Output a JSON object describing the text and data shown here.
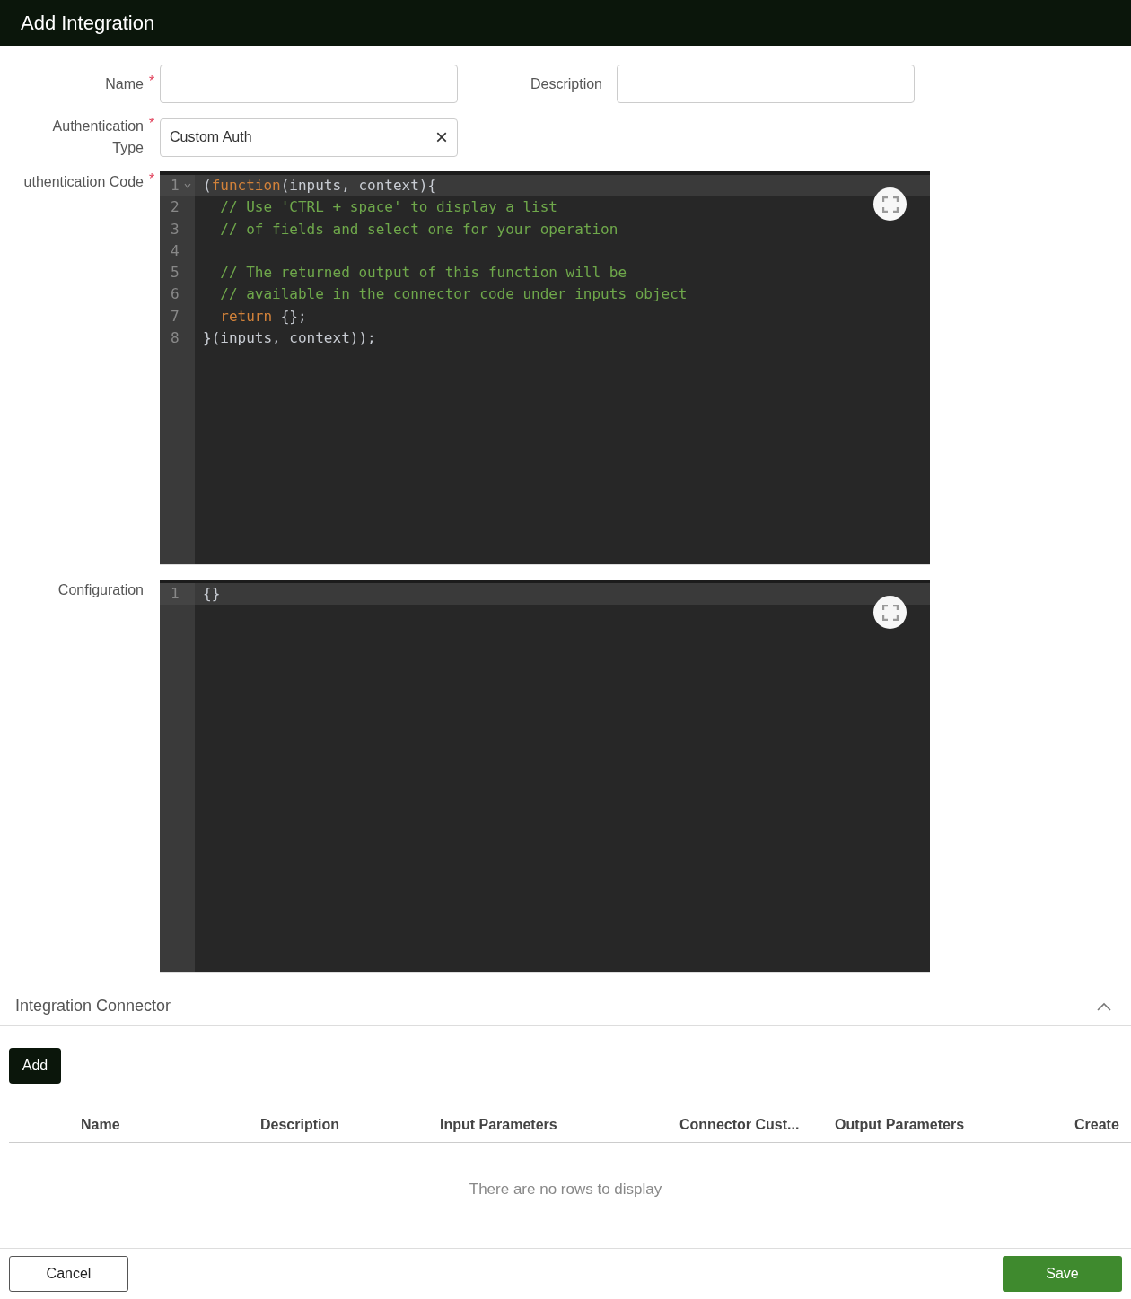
{
  "window": {
    "title": "Add Integration"
  },
  "form": {
    "name": {
      "label": "Name",
      "required_marker": "*"
    },
    "description": {
      "label": "Description"
    },
    "auth_type": {
      "label": "Authentication Type",
      "required_marker": "*",
      "value": "Custom Auth",
      "clear": "×"
    }
  },
  "editors": [
    {
      "label": "uthentication Code",
      "required_marker": "*",
      "lines": [
        {
          "number": "1",
          "foldable": true,
          "active": true,
          "tokens": [
            {
              "kind": "plain",
              "text": "("
            },
            {
              "kind": "keyword",
              "text": "function"
            },
            {
              "kind": "plain",
              "text": "(inputs, context){"
            }
          ]
        },
        {
          "number": "2",
          "foldable": false,
          "active": false,
          "tokens": [
            {
              "kind": "comment",
              "text": "  // Use 'CTRL + space' to display a list"
            }
          ]
        },
        {
          "number": "3",
          "foldable": false,
          "active": false,
          "tokens": [
            {
              "kind": "comment",
              "text": "  // of fields and select one for your operation"
            }
          ]
        },
        {
          "number": "4",
          "foldable": false,
          "active": false
        },
        {
          "number": "5",
          "foldable": false,
          "active": false,
          "tokens": [
            {
              "kind": "comment",
              "text": "  // The returned output of this function will be"
            }
          ]
        },
        {
          "number": "6",
          "foldable": false,
          "active": false,
          "tokens": [
            {
              "kind": "comment",
              "text": "  // available in the connector code under inputs object"
            }
          ]
        },
        {
          "number": "7",
          "foldable": false,
          "active": false,
          "tokens": [
            {
              "kind": "keyword",
              "text": "  return"
            },
            {
              "kind": "plain",
              "text": " {};"
            }
          ]
        },
        {
          "number": "8",
          "foldable": false,
          "active": false,
          "tokens": [
            {
              "kind": "plain",
              "text": "}(inputs, context));"
            }
          ]
        }
      ]
    },
    {
      "label": "Configuration",
      "lines": [
        {
          "number": "1",
          "foldable": false,
          "active": true,
          "tokens": [
            {
              "kind": "plain",
              "text": "{}"
            }
          ]
        }
      ]
    }
  ],
  "connector": {
    "title": "Integration Connector",
    "expanded": true,
    "add_button": "Add",
    "table": {
      "columns": [
        "Name",
        "Description",
        "Input Parameters",
        "Connector Cust...",
        "Output Parameters",
        "Create"
      ],
      "empty_message": "There are no rows to display"
    }
  },
  "footer": {
    "cancel": "Cancel",
    "save": "Save"
  }
}
